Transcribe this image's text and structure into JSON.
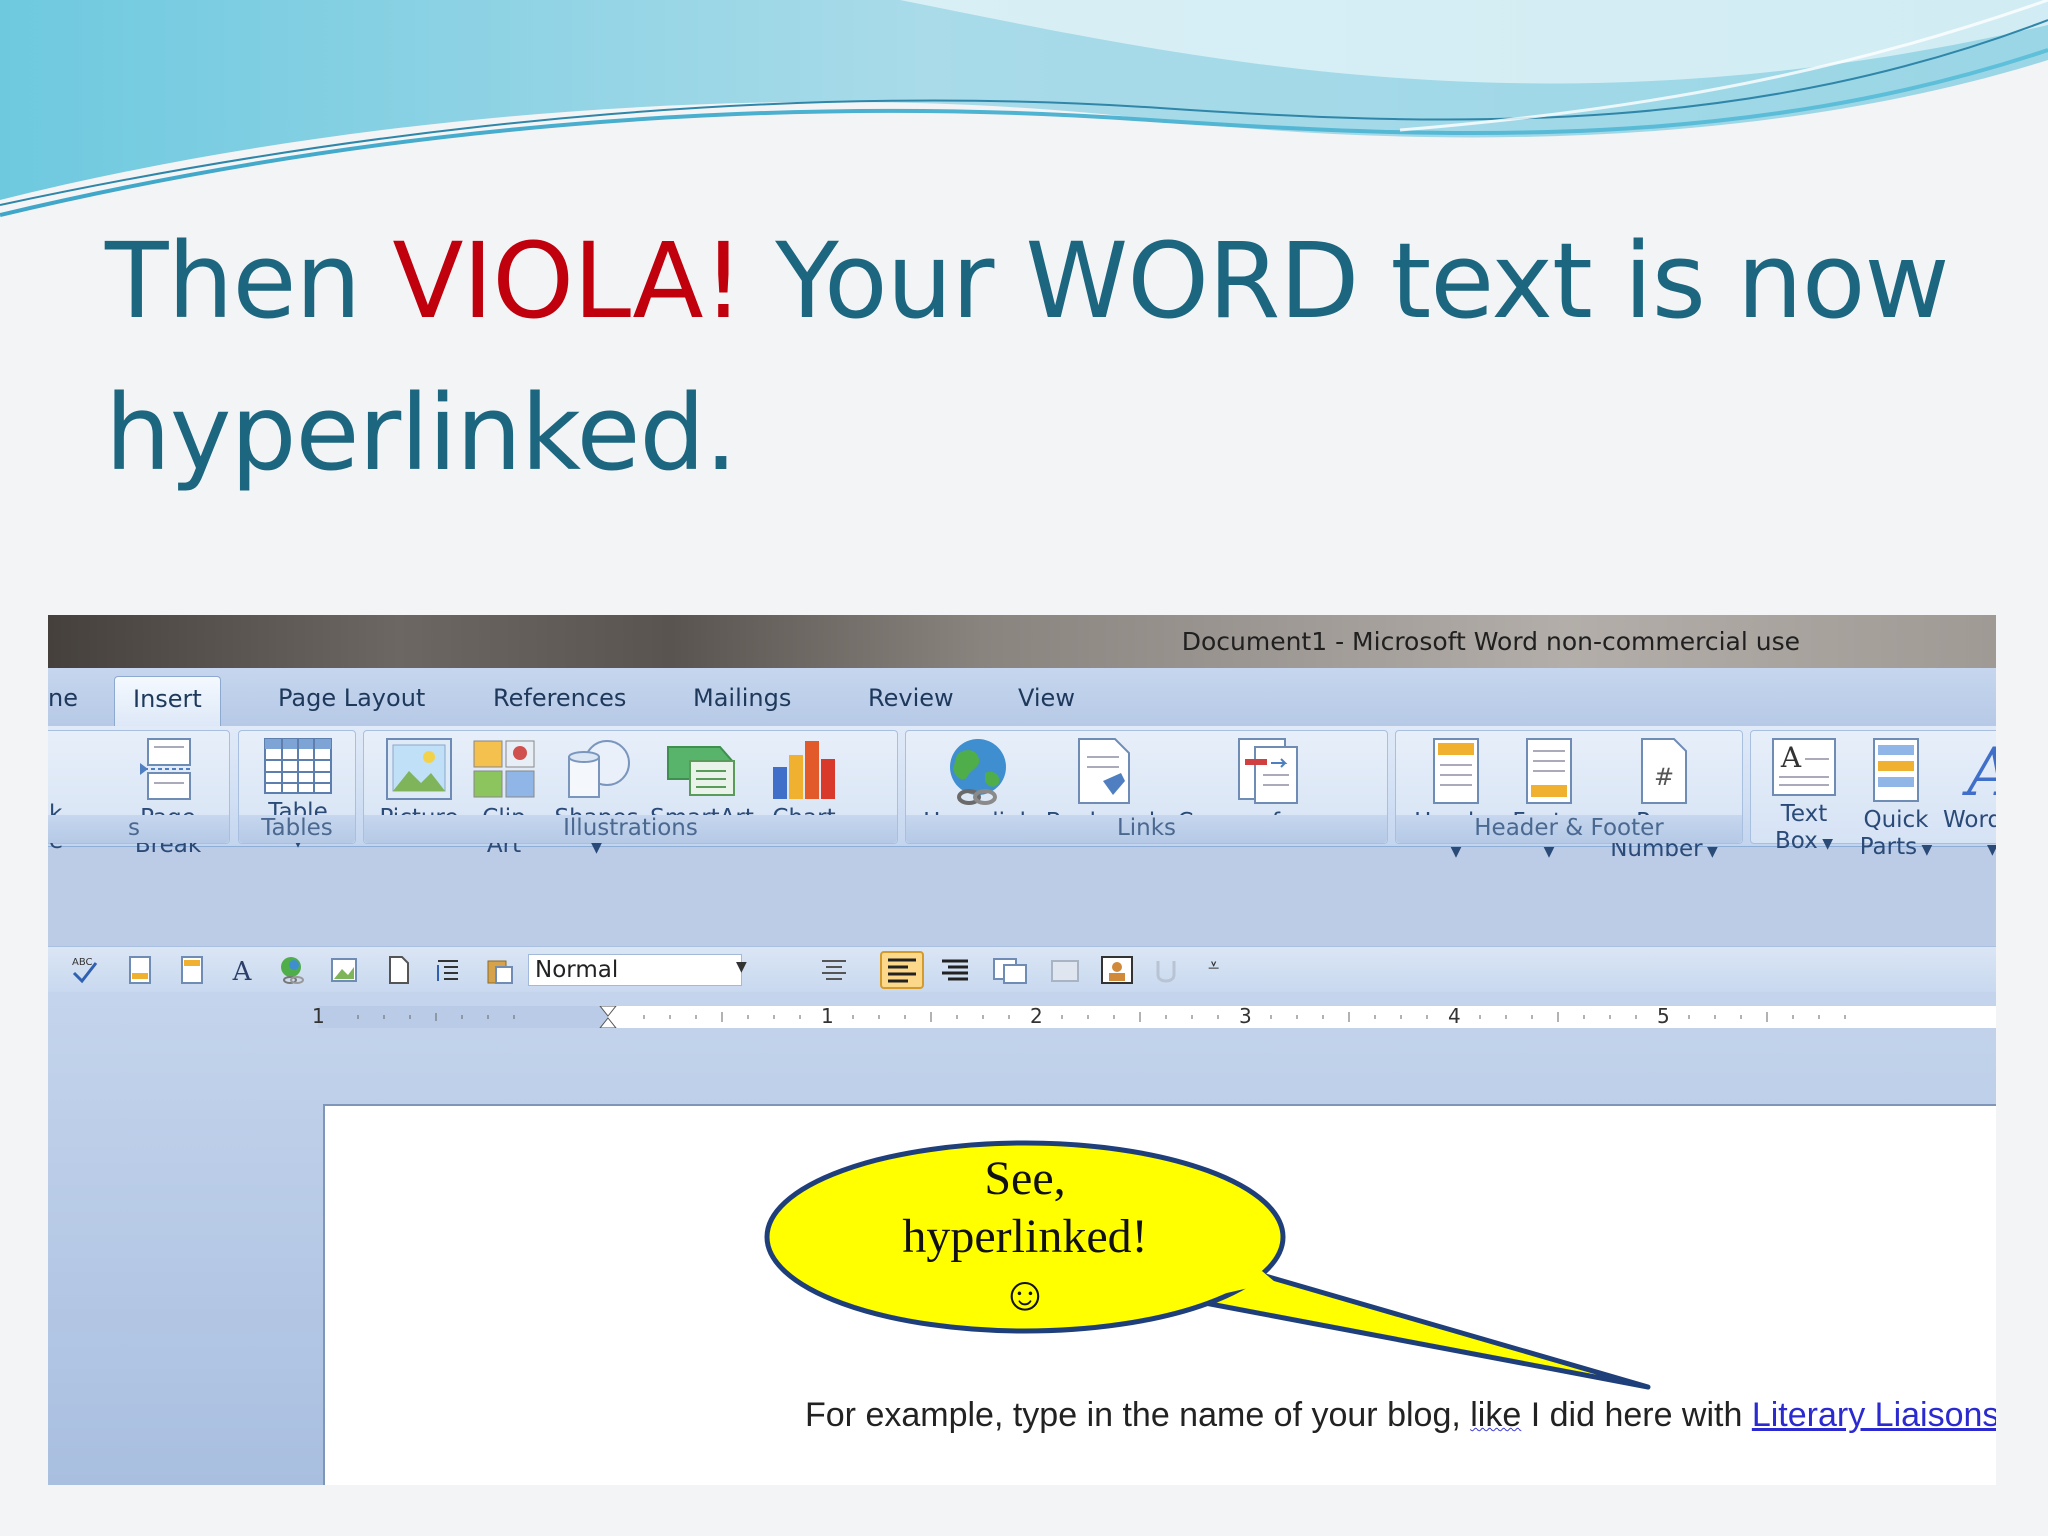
{
  "slide": {
    "title_prefix": "Then ",
    "title_accent": "VIOLA!",
    "title_rest": " Your WORD text is now hyperlinked."
  },
  "window": {
    "title": "Document1  -  Microsoft Word non-commercial use"
  },
  "tabs": [
    {
      "label": "ne"
    },
    {
      "label": "Insert",
      "active": true
    },
    {
      "label": "Page Layout"
    },
    {
      "label": "References"
    },
    {
      "label": "Mailings"
    },
    {
      "label": "Review"
    },
    {
      "label": "View"
    }
  ],
  "ribbon": {
    "groups": {
      "pages_partial": "s",
      "tables": "Tables",
      "illustrations": "Illustrations",
      "links": "Links",
      "header_footer": "Header & Footer"
    },
    "buttons": {
      "partial_left_1": "k",
      "partial_left_2": "e",
      "page_break_1": "Page",
      "page_break_2": "Break",
      "table": "Table",
      "picture": "Picture",
      "clip_art_1": "Clip",
      "clip_art_2": "Art",
      "shapes": "Shapes",
      "smartart": "SmartArt",
      "chart": "Chart",
      "hyperlink": "Hyperlink",
      "bookmark": "Bookmark",
      "cross_reference": "Cross-reference",
      "header": "Header",
      "footer": "Footer",
      "page_number_1": "Page",
      "page_number_2": "Number",
      "text_box_1": "Text",
      "text_box_2": "Box",
      "quick_parts_1": "Quick",
      "quick_parts_2": "Parts",
      "wordart": "WordA"
    }
  },
  "toolbar": {
    "style_value": "Normal"
  },
  "ruler": {
    "numbers": [
      "1",
      "1",
      "2",
      "3",
      "4",
      "5"
    ]
  },
  "document": {
    "text_before": "For example, type in the name of your blog, ",
    "text_squiggle": "like",
    "text_after": " I did here with ",
    "link_text": "Literary Liaisons"
  },
  "callout": {
    "line1": "See,",
    "line2": "hyperlinked!",
    "line3": "☺",
    "fill_color": "#ffff00",
    "stroke_color": "#1f3f7a"
  }
}
